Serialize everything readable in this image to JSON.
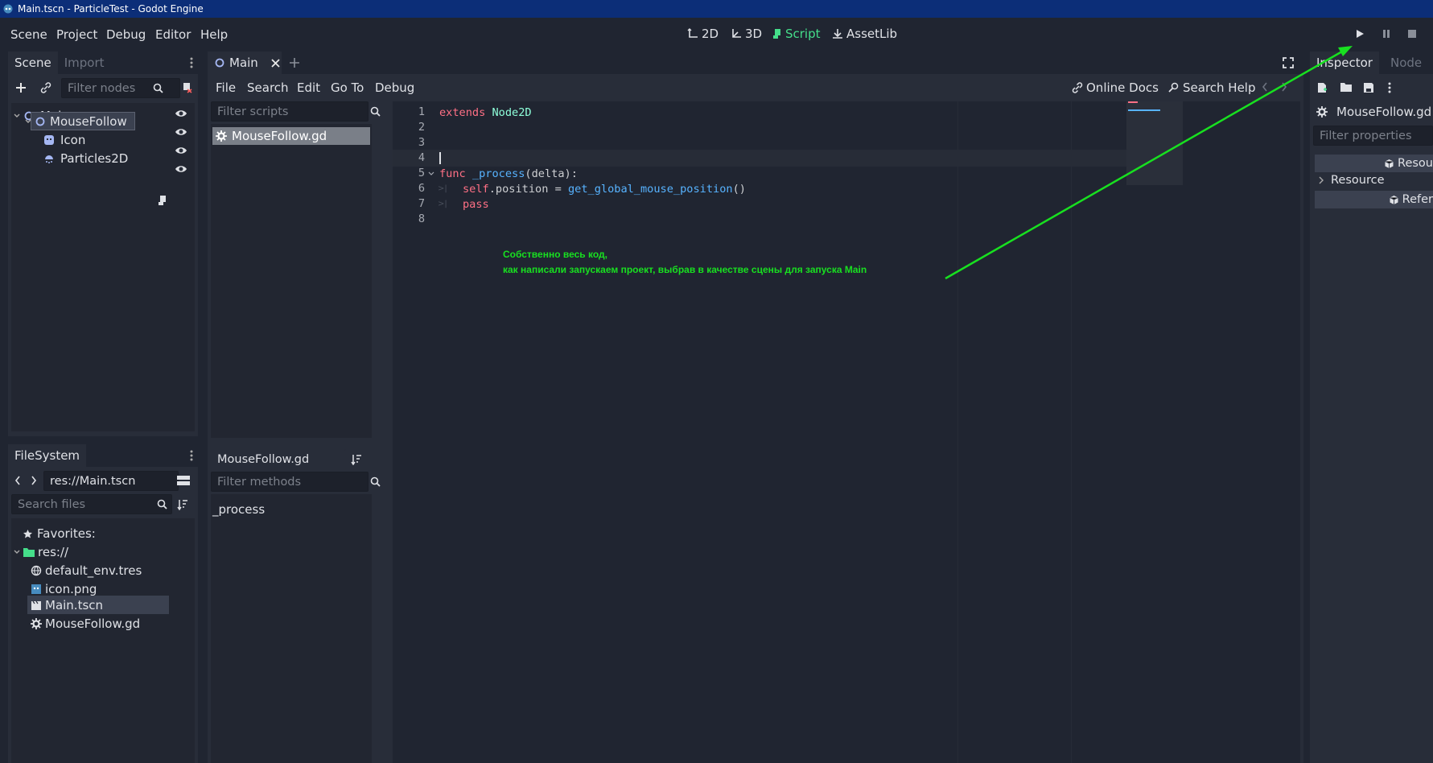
{
  "titlebar": {
    "title": "Main.tscn - ParticleTest - Godot Engine"
  },
  "menubar": {
    "items": [
      "Scene",
      "Project",
      "Debug",
      "Editor",
      "Help"
    ],
    "workspaces": [
      "2D",
      "3D",
      "Script",
      "AssetLib"
    ]
  },
  "scene_dock": {
    "tabs": [
      "Scene",
      "Import"
    ],
    "filter_placeholder": "Filter nodes",
    "nodes": [
      "Main",
      "MouseFollow",
      "Icon",
      "Particles2D"
    ]
  },
  "filesystem_dock": {
    "tab": "FileSystem",
    "path": "res://Main.tscn",
    "search_placeholder": "Search files",
    "favorites": "Favorites:",
    "root": "res://",
    "files": [
      "default_env.tres",
      "icon.png",
      "Main.tscn",
      "MouseFollow.gd"
    ]
  },
  "script_editor": {
    "tabs": [
      "Main"
    ],
    "menu": [
      "File",
      "Search",
      "Edit",
      "Go To",
      "Debug"
    ],
    "online_docs": "Online Docs",
    "search_help": "Search Help",
    "filter_scripts_placeholder": "Filter scripts",
    "scripts": [
      "MouseFollow.gd"
    ],
    "current_script": "MouseFollow.gd",
    "filter_methods_placeholder": "Filter methods",
    "methods": [
      "_process"
    ],
    "line_numbers": [
      "1",
      "2",
      "3",
      "4",
      "5",
      "6",
      "7",
      "8"
    ],
    "code": {
      "l1_kw": "extends",
      "l1_type": "Node2D",
      "l5_kw": "func",
      "l5_fn": "_process",
      "l5_rest": "(delta):",
      "l6_self": "self",
      "l6_mid": ".position = ",
      "l6_call": "get_global_mouse_position",
      "l6_end": "()",
      "l7_kw": "pass"
    }
  },
  "annotation": {
    "line1": "Собственно весь код,",
    "line2": "как написали запускаем проект, выбрав в качестве сцены для запуска Main",
    "color": "#18e020"
  },
  "inspector": {
    "tabs": [
      "Inspector",
      "Node"
    ],
    "resource_name": "MouseFollow.gd",
    "filter_placeholder": "Filter properties",
    "section1": "Resou",
    "group": "Resource",
    "section2": "Refer"
  },
  "colors": {
    "accent": "#45de8a",
    "bg": "#202531",
    "panel": "#282d39"
  }
}
